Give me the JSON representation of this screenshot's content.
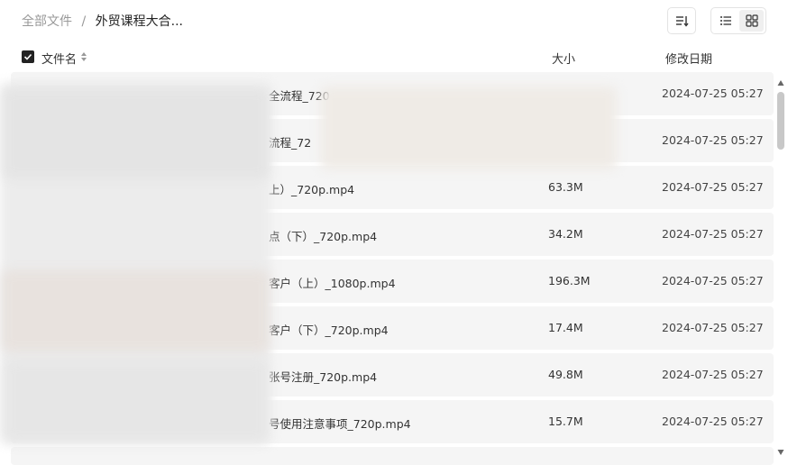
{
  "breadcrumb": {
    "root": "全部文件",
    "separator": "/",
    "current": "外贸课程大合..."
  },
  "toolbar": {
    "sort_icon": "sort-icon",
    "list_view_icon": "list-view-icon",
    "grid_view_icon": "grid-view-icon"
  },
  "table": {
    "headers": {
      "name": "文件名",
      "size": "大小",
      "date": "修改日期"
    },
    "rows": [
      {
        "name": "全流程_720",
        "size": "",
        "date": "2024-07-25 05:27"
      },
      {
        "name": "流程_72",
        "size": "",
        "date": "2024-07-25 05:27"
      },
      {
        "name": "上）_720p.mp4",
        "size": "63.3M",
        "date": "2024-07-25 05:27"
      },
      {
        "name": "点（下）_720p.mp4",
        "size": "34.2M",
        "date": "2024-07-25 05:27"
      },
      {
        "name": "客户（上）_1080p.mp4",
        "size": "196.3M",
        "date": "2024-07-25 05:27"
      },
      {
        "name": "客户（下）_720p.mp4",
        "size": "17.4M",
        "date": "2024-07-25 05:27"
      },
      {
        "name": "张号注册_720p.mp4",
        "size": "49.8M",
        "date": "2024-07-25 05:27"
      },
      {
        "name": "号使用注意事项_720p.mp4",
        "size": "15.7M",
        "date": "2024-07-25 05:27"
      }
    ]
  },
  "colors": {
    "row_bg": "#f5f5f5",
    "muted_text": "#999999",
    "checkbox": "#222222"
  }
}
